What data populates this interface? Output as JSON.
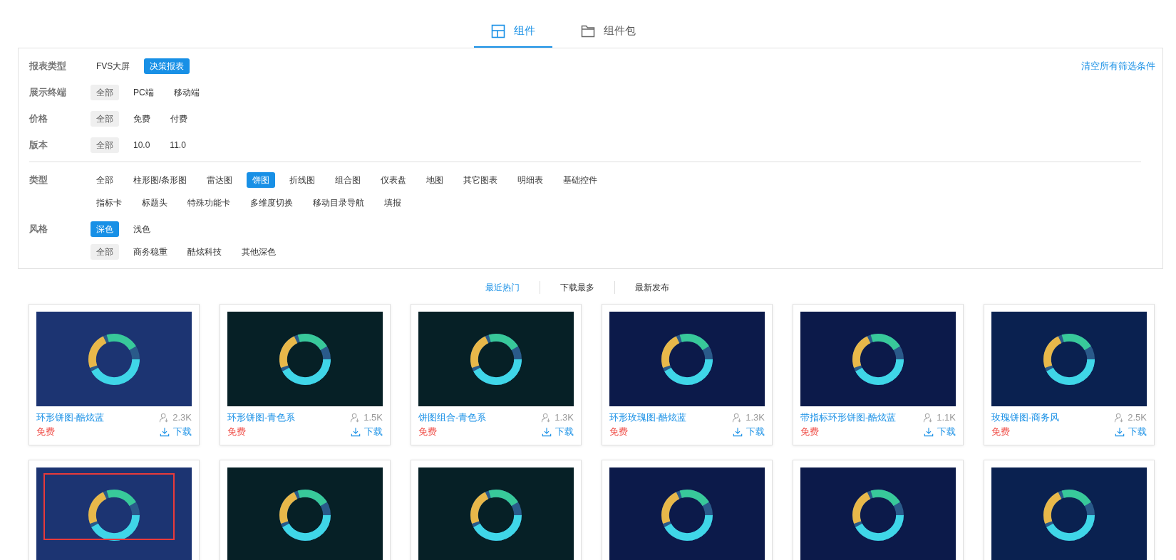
{
  "tabs": [
    {
      "label": "组件",
      "selected": true
    },
    {
      "label": "组件包",
      "selected": false
    }
  ],
  "clear_filters": "清空所有筛选条件",
  "filter_groups": [
    {
      "rows": [
        {
          "label": "报表类型",
          "kind": "primary",
          "options": [
            {
              "label": "FVS大屏",
              "selected": false
            },
            {
              "label": "决策报表",
              "selected": true
            }
          ]
        },
        {
          "label": "展示终端",
          "kind": "default",
          "options": [
            {
              "label": "全部",
              "selected": true
            },
            {
              "label": "PC端",
              "selected": false
            },
            {
              "label": "移动端",
              "selected": false
            }
          ]
        },
        {
          "label": "价格",
          "kind": "default",
          "options": [
            {
              "label": "全部",
              "selected": true
            },
            {
              "label": "免费",
              "selected": false
            },
            {
              "label": "付费",
              "selected": false
            }
          ]
        },
        {
          "label": "版本",
          "kind": "default",
          "options": [
            {
              "label": "全部",
              "selected": true
            },
            {
              "label": "10.0",
              "selected": false
            },
            {
              "label": "11.0",
              "selected": false
            }
          ]
        }
      ]
    },
    {
      "rows": [
        {
          "label": "类型",
          "kind": "primary",
          "options": [
            {
              "label": "全部",
              "selected": false
            },
            {
              "label": "柱形图/条形图",
              "selected": false
            },
            {
              "label": "雷达图",
              "selected": false
            },
            {
              "label": "饼图",
              "selected": true
            },
            {
              "label": "折线图",
              "selected": false
            },
            {
              "label": "组合图",
              "selected": false
            },
            {
              "label": "仪表盘",
              "selected": false
            },
            {
              "label": "地图",
              "selected": false
            },
            {
              "label": "其它图表",
              "selected": false
            },
            {
              "label": "明细表",
              "selected": false
            },
            {
              "label": "基础控件",
              "selected": false
            },
            {
              "label": "指标卡",
              "selected": false
            },
            {
              "label": "标题头",
              "selected": false
            },
            {
              "label": "特殊功能卡",
              "selected": false
            },
            {
              "label": "多维度切换",
              "selected": false
            },
            {
              "label": "移动目录导航",
              "selected": false
            },
            {
              "label": "填报",
              "selected": false
            }
          ]
        },
        {
          "label": "风格",
          "kind": "primary",
          "options": [
            {
              "label": "深色",
              "selected": true
            },
            {
              "label": "浅色",
              "selected": false
            }
          ],
          "sub_options": {
            "kind": "default",
            "options": [
              {
                "label": "全部",
                "selected": true
              },
              {
                "label": "商务稳重",
                "selected": false
              },
              {
                "label": "酷炫科技",
                "selected": false
              },
              {
                "label": "其他深色",
                "selected": false
              }
            ]
          }
        }
      ]
    }
  ],
  "sort_tabs": [
    {
      "label": "最近热门",
      "selected": true
    },
    {
      "label": "下载最多",
      "selected": false
    },
    {
      "label": "最新发布",
      "selected": false
    }
  ],
  "cards": [
    {
      "title": "环形饼图-酷炫蓝",
      "downloads": "2.3K",
      "price": "免费",
      "download_label": "下载",
      "highlighted": false
    },
    {
      "title": "环形饼图-青色系",
      "downloads": "1.5K",
      "price": "免费",
      "download_label": "下载",
      "highlighted": false
    },
    {
      "title": "饼图组合-青色系",
      "downloads": "1.3K",
      "price": "免费",
      "download_label": "下载",
      "highlighted": false
    },
    {
      "title": "环形玫瑰图-酷炫蓝",
      "downloads": "1.3K",
      "price": "免费",
      "download_label": "下载",
      "highlighted": false
    },
    {
      "title": "带指标环形饼图-酷炫蓝",
      "downloads": "1.1K",
      "price": "免费",
      "download_label": "下载",
      "highlighted": false
    },
    {
      "title": "玫瑰饼图-商务风",
      "downloads": "2.5K",
      "price": "免费",
      "download_label": "下载",
      "highlighted": false
    },
    {
      "highlighted": true
    },
    {
      "highlighted": false
    },
    {
      "highlighted": false
    },
    {
      "highlighted": false
    },
    {
      "highlighted": false
    },
    {
      "highlighted": false
    }
  ]
}
